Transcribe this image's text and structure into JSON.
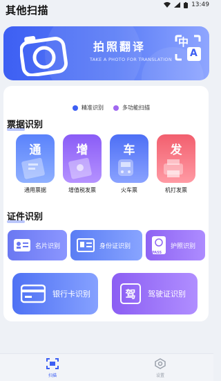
{
  "statusbar": {
    "time": "13:49"
  },
  "page": {
    "title": "其他扫描"
  },
  "banner": {
    "title": "拍照翻译",
    "subtitle": "TAKE A PHOTO FOR TRANSLATION",
    "trans_top": "中",
    "trans_bottom": "A"
  },
  "legend": [
    {
      "label": "精准识别",
      "color": "#3d5ff3"
    },
    {
      "label": "多功能扫描",
      "color": "#a068f0"
    }
  ],
  "tickets": {
    "title": "票据识别",
    "items": [
      {
        "glyph": "通",
        "label": "通用票据",
        "color_a": "#5a82fb",
        "color_b": "#8fb0ff"
      },
      {
        "glyph": "增",
        "label": "增值税发票",
        "color_a": "#8a5cf6",
        "color_b": "#b592ff"
      },
      {
        "glyph": "车",
        "label": "火车票",
        "color_a": "#4d6ff5",
        "color_b": "#8aa2ff"
      },
      {
        "glyph": "发",
        "label": "机打发票",
        "color_a": "#f25f6e",
        "color_b": "#ff9aa4"
      }
    ]
  },
  "ids": {
    "title": "证件识别",
    "card_label": "名片识别",
    "idcard_label": "身份证识别",
    "passport_label": "护照识别",
    "passport_text": "PASS",
    "bank_label": "银行卡识别",
    "license_label": "驾驶证识别",
    "license_glyph": "驾"
  },
  "tabbar": {
    "scan_label": "扫描",
    "settings_label": "设置"
  },
  "colors": {
    "accent": "#3d5ff3",
    "purple": "#a068f0"
  }
}
